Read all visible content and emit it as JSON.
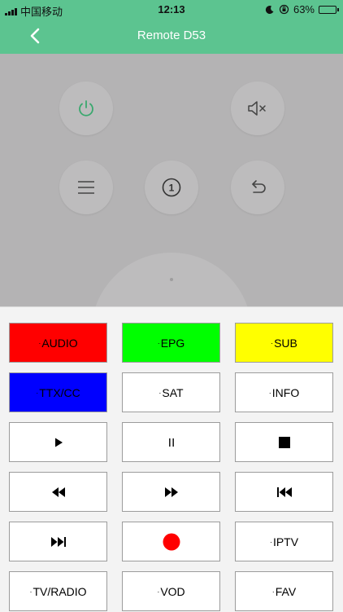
{
  "status_bar": {
    "carrier": "中国移动",
    "time": "12:13",
    "battery": "63%",
    "battery_level": 0.63,
    "icons": [
      "signal-icon",
      "moon-icon",
      "orientation-lock-icon",
      "battery-icon"
    ]
  },
  "nav": {
    "title": "Remote D53",
    "back_icon": "chevron-left-icon"
  },
  "remote": {
    "power_icon": "power-icon",
    "mute_icon": "mute-icon",
    "menu_icon": "menu-icon",
    "number_icon": "number-one-icon",
    "number_label": "1",
    "return_icon": "return-icon",
    "accent_color": "#3aa86e"
  },
  "keypad": {
    "audio": "AUDIO",
    "epg": "EPG",
    "sub": "SUB",
    "ttx": "TTX/CC",
    "sat": "SAT",
    "info": "INFO",
    "iptv": "IPTV",
    "tv_radio": "TV/RADIO",
    "vod": "VOD",
    "fav": "FAV",
    "play_icon": "play-icon",
    "pause_icon": "pause-icon",
    "stop_icon": "stop-icon",
    "rewind_icon": "rewind-icon",
    "fast_forward_icon": "fast-forward-icon",
    "previous_icon": "skip-previous-icon",
    "next_icon": "skip-next-icon",
    "record_icon": "record-icon",
    "colors": {
      "audio": "#ff0000",
      "epg": "#00ff00",
      "sub": "#ffff00",
      "ttx": "#0000ff",
      "record": "#ff0000"
    }
  }
}
